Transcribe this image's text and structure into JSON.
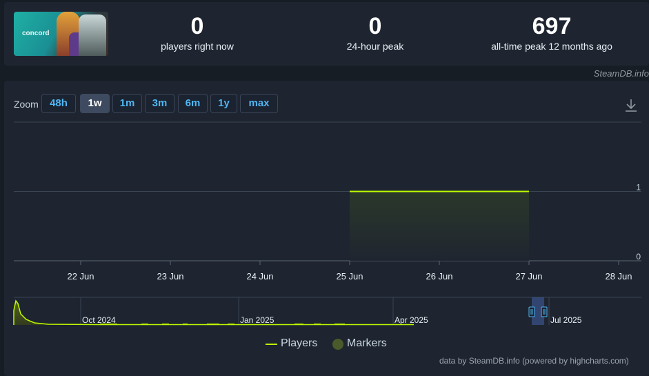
{
  "stats": {
    "image_alt": "concord",
    "logo_text": "concord",
    "now": {
      "value": "0",
      "label": "players right now"
    },
    "peak24": {
      "value": "0",
      "label": "24-hour peak"
    },
    "alltime": {
      "value": "697",
      "label": "all-time peak 12 months ago"
    }
  },
  "watermark": "SteamDB.info",
  "zoom": {
    "label": "Zoom",
    "buttons": [
      "48h",
      "1w",
      "1m",
      "3m",
      "6m",
      "1y",
      "max"
    ],
    "active": "1w"
  },
  "icons": {
    "download": "download-icon"
  },
  "chart_data": {
    "type": "area",
    "series": [
      {
        "name": "Players",
        "color": "#befc00",
        "x": [
          "25 Jun",
          "27 Jun"
        ],
        "values": [
          1,
          1
        ]
      }
    ],
    "x_ticks": [
      "22 Jun",
      "23 Jun",
      "24 Jun",
      "25 Jun",
      "26 Jun",
      "27 Jun",
      "28 Jun"
    ],
    "y_ticks": [
      "0",
      "1"
    ],
    "ylim": [
      0,
      2
    ],
    "grid": true,
    "legend": {
      "position": "bottom-center",
      "entries": [
        "Players",
        "Markers"
      ]
    },
    "navigator": {
      "labels": [
        "Oct 2024",
        "Jan 2025",
        "Apr 2025",
        "Jul 2025"
      ]
    }
  },
  "colors": {
    "accent": "#befc00",
    "zoom_text": "#4fb6f2",
    "marker": "#4a5a2a"
  },
  "credits": "data by SteamDB.info (powered by highcharts.com)"
}
